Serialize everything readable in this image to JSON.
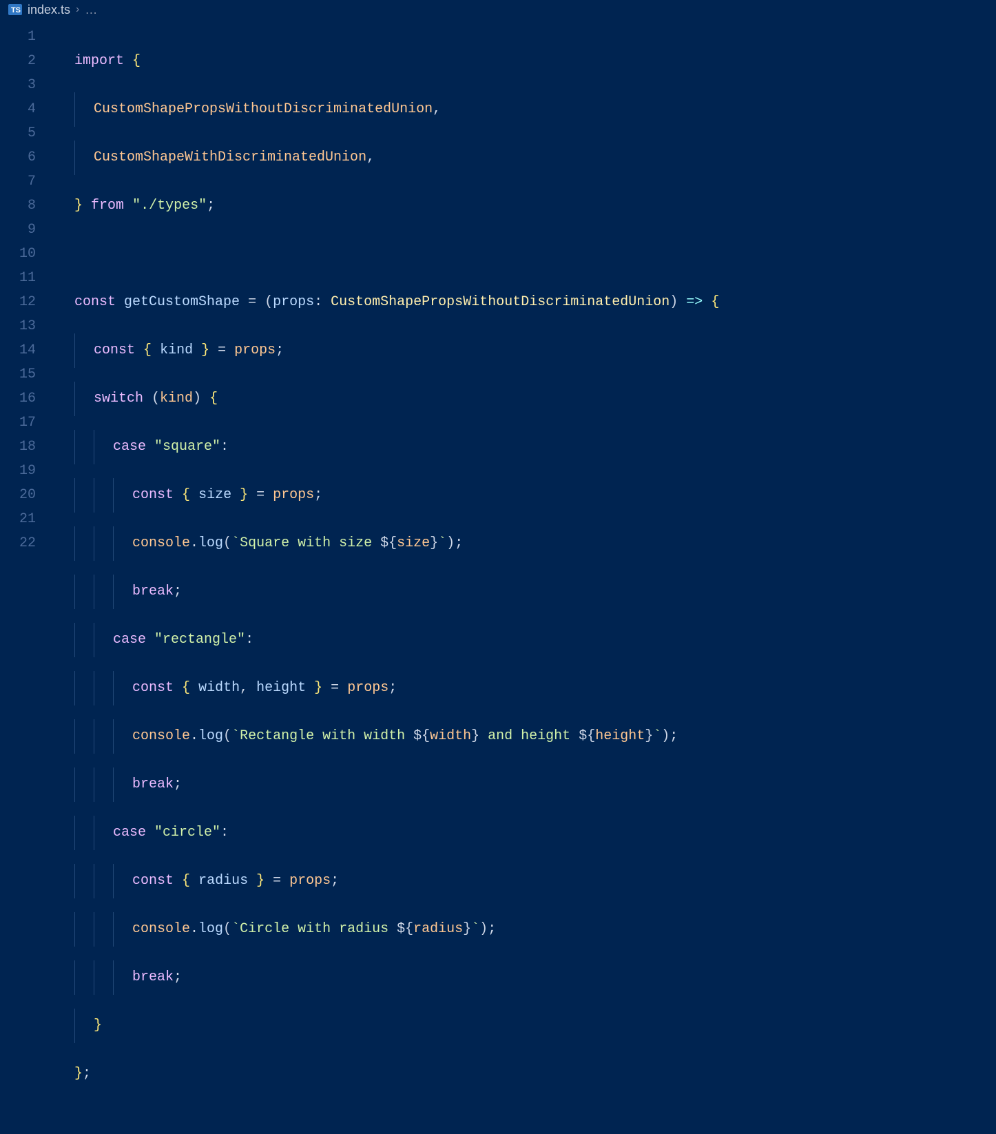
{
  "breadcrumb": {
    "ts_icon_label": "TS",
    "filename": "index.ts",
    "separator": "›",
    "ellipsis": "…"
  },
  "gutter": {
    "start": 1,
    "end": 22
  },
  "code": {
    "l1": {
      "a": "import",
      "b": "{"
    },
    "l2": {
      "a": "CustomShapePropsWithoutDiscriminatedUnion",
      "b": ","
    },
    "l3": {
      "a": "CustomShapeWithDiscriminatedUnion",
      "b": ","
    },
    "l4": {
      "a": "}",
      "b": "from",
      "c": "\"./types\"",
      "d": ";"
    },
    "l6": {
      "a": "const",
      "b": "getCustomShape",
      "c": "=",
      "d": "(",
      "e": "props",
      "f": ": ",
      "g": "CustomShapePropsWithoutDiscriminatedUnion",
      "h": ")",
      "i": "=>",
      "j": "{"
    },
    "l7": {
      "a": "const",
      "b": "{",
      "c": "kind",
      "d": "}",
      "e": "=",
      "f": "props",
      "g": ";"
    },
    "l8": {
      "a": "switch",
      "b": "(",
      "c": "kind",
      "d": ")",
      "e": "{"
    },
    "l9": {
      "a": "case",
      "b": "\"square\"",
      "c": ":"
    },
    "l10": {
      "a": "const",
      "b": "{",
      "c": "size",
      "d": "}",
      "e": "=",
      "f": "props",
      "g": ";"
    },
    "l11": {
      "a": "console",
      "b": ".",
      "c": "log",
      "d": "(",
      "e": "`Square with size ",
      "f": "${",
      "g": "size",
      "h": "}",
      "i": "`",
      "j": ")",
      "k": ";"
    },
    "l12": {
      "a": "break",
      "b": ";"
    },
    "l13": {
      "a": "case",
      "b": "\"rectangle\"",
      "c": ":"
    },
    "l14": {
      "a": "const",
      "b": "{",
      "c": "width",
      "d": ",",
      "e": "height",
      "f": "}",
      "g": "=",
      "h": "props",
      "i": ";"
    },
    "l15": {
      "a": "console",
      "b": ".",
      "c": "log",
      "d": "(",
      "e": "`Rectangle with width ",
      "f": "${",
      "g": "width",
      "h": "}",
      "i": " and height ",
      "j": "${",
      "k": "height",
      "l": "}",
      "m": "`",
      "n": ")",
      "o": ";"
    },
    "l16": {
      "a": "break",
      "b": ";"
    },
    "l17": {
      "a": "case",
      "b": "\"circle\"",
      "c": ":"
    },
    "l18": {
      "a": "const",
      "b": "{",
      "c": "radius",
      "d": "}",
      "e": "=",
      "f": "props",
      "g": ";"
    },
    "l19": {
      "a": "console",
      "b": ".",
      "c": "log",
      "d": "(",
      "e": "`Circle with radius ",
      "f": "${",
      "g": "radius",
      "h": "}",
      "i": "`",
      "j": ")",
      "k": ";"
    },
    "l20": {
      "a": "break",
      "b": ";"
    },
    "l21": {
      "a": "}"
    },
    "l22": {
      "a": "}",
      "b": ";"
    }
  }
}
